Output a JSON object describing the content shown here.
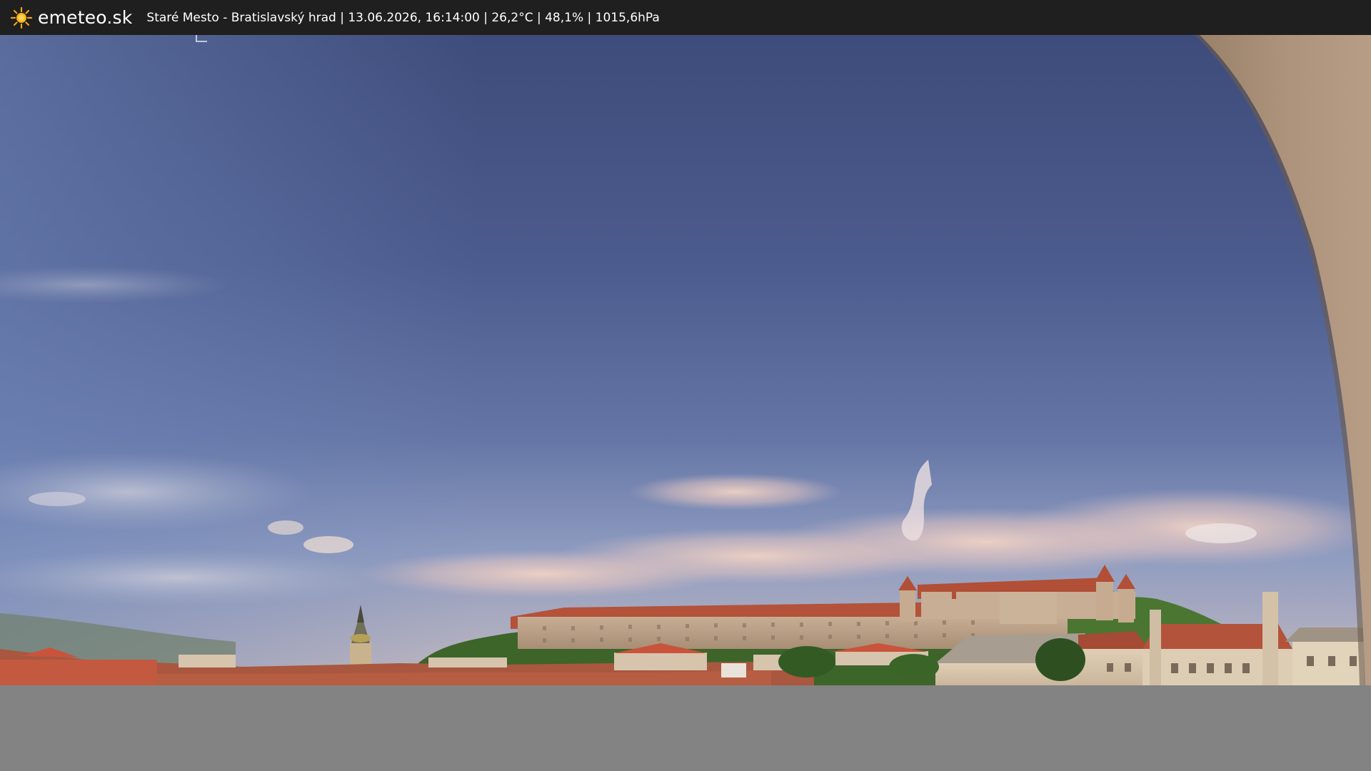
{
  "brand": {
    "name": "emeteo.sk",
    "icon": "sun-icon",
    "icon_color": "#f4a11a"
  },
  "caption": {
    "text": "Staré Mesto - Bratislavský hrad | 13.06.2026, 16:14:00 | 26,2°C | 48,1% | 1015,6hPa"
  },
  "colors": {
    "topbar_bg": "#1f1f1f",
    "sky_top": "#3f4d7c",
    "sky_mid": "#5f6f9f",
    "sky_low": "#a9aec2",
    "castle_roof": "#b6523a",
    "castle_wall": "#c9b39a",
    "trees": "#3f6a2a",
    "wall_right": "#a98f78",
    "filler": "#838383"
  }
}
